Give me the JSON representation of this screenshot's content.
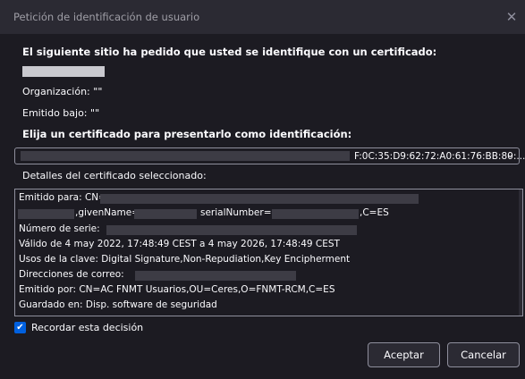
{
  "window": {
    "title": "Petición de identificación de usuario",
    "close_icon": "close-icon"
  },
  "dialog": {
    "heading": "El siguiente sitio ha pedido que usted se identifique con un certificado:",
    "organization_label": "Organización: \"\"",
    "issued_under_label": "Emitido bajo: \"\"",
    "choose_label": "Elija un certificado para presentarlo como identificación:",
    "certificate_select_value": "F:0C:35:D9:62:72:A0:61:76:BB:80:...",
    "details_label": "Detalles del certificado seleccionado:",
    "details": {
      "issued_to_prefix": "Emitido para: CN=",
      "given_name_label": ",givenName=",
      "serial_number_label": "serialNumber=",
      "country_suffix": ",C=ES",
      "serial_label": "Número de serie:",
      "validity": "Válido de 4 may 2022, 17:48:49 CEST a 4 may 2026, 17:48:49 CEST",
      "key_usage": "Usos de la clave: Digital Signature,Non-Repudiation,Key Encipherment",
      "email_label": "Direcciones de correo:",
      "issuer": "Emitido por: CN=AC FNMT Usuarios,OU=Ceres,O=FNMT-RCM,C=ES",
      "stored_in": "Guardado en: Disp. software de seguridad"
    },
    "remember_label": "Recordar esta decisión",
    "remember_checked": true,
    "accept_label": "Aceptar",
    "cancel_label": "Cancelar"
  },
  "colors": {
    "background": "#1c1b22",
    "titlebar": "#2b2a33",
    "accent": "#0060df",
    "redaction": "#3d3c45"
  }
}
